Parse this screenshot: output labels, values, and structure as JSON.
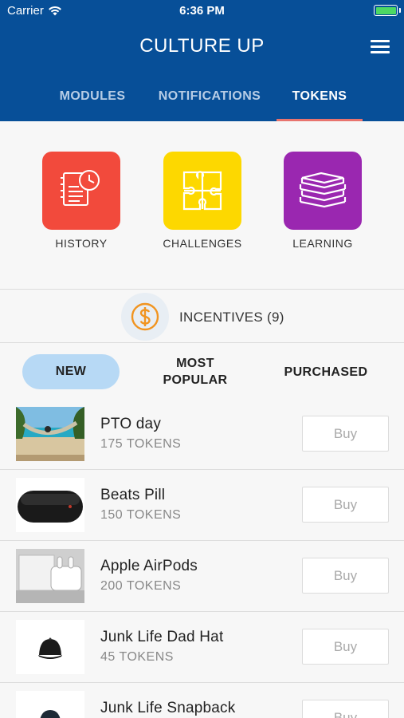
{
  "status_bar": {
    "carrier": "Carrier",
    "time": "6:36 PM"
  },
  "header": {
    "title": "CULTURE UP"
  },
  "tabs": [
    {
      "label": "MODULES",
      "active": false
    },
    {
      "label": "NOTIFICATIONS",
      "active": false
    },
    {
      "label": "TOKENS",
      "active": true
    }
  ],
  "categories": [
    {
      "label": "HISTORY",
      "icon": "history-icon",
      "color": "#f24a3c"
    },
    {
      "label": "CHALLENGES",
      "icon": "puzzle-icon",
      "color": "#fdd800"
    },
    {
      "label": "LEARNING",
      "icon": "books-icon",
      "color": "#9a27b0"
    }
  ],
  "incentives": {
    "label": "INCENTIVES (9)",
    "icon": "dollar-coin-icon",
    "icon_color": "#f19420"
  },
  "filters": [
    {
      "label": "NEW",
      "active": true
    },
    {
      "label_line1": "MOST",
      "label_line2": "POPULAR",
      "active": false
    },
    {
      "label": "PURCHASED",
      "active": false
    }
  ],
  "items": [
    {
      "name": "PTO day",
      "price": "175 TOKENS",
      "buy_label": "Buy"
    },
    {
      "name": "Beats Pill",
      "price": "150 TOKENS",
      "buy_label": "Buy"
    },
    {
      "name": "Apple AirPods",
      "price": "200 TOKENS",
      "buy_label": "Buy"
    },
    {
      "name": "Junk Life Dad Hat",
      "price": "45 TOKENS",
      "buy_label": "Buy"
    },
    {
      "name": "Junk Life Snapback",
      "price": "",
      "buy_label": "Buy"
    }
  ],
  "colors": {
    "header": "#074f98",
    "tab_underline": "#e8746e",
    "active_filter": "#b7d9f5"
  }
}
